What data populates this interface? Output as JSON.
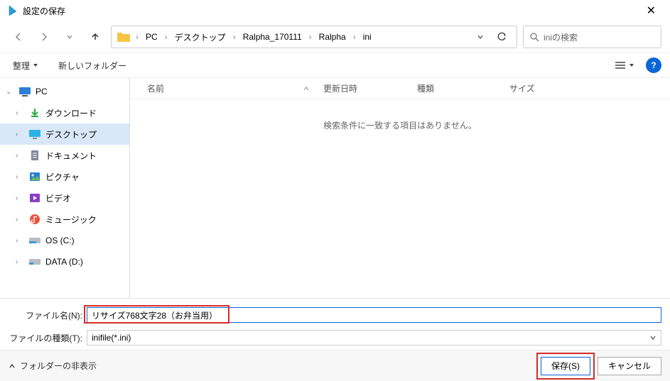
{
  "window": {
    "title": "設定の保存"
  },
  "nav": {
    "path": [
      "PC",
      "デスクトップ",
      "Ralpha_170111",
      "Ralpha",
      "ini"
    ],
    "search_placeholder": "iniの検索"
  },
  "toolbar": {
    "organize": "整理",
    "new_folder": "新しいフォルダー"
  },
  "sidebar": {
    "items": [
      {
        "label": "PC",
        "icon": "pc",
        "expandable": true,
        "expanded": true
      },
      {
        "label": "ダウンロード",
        "icon": "download",
        "expandable": true
      },
      {
        "label": "デスクトップ",
        "icon": "desktop",
        "expandable": true,
        "selected": true
      },
      {
        "label": "ドキュメント",
        "icon": "document",
        "expandable": true
      },
      {
        "label": "ピクチャ",
        "icon": "pictures",
        "expandable": true
      },
      {
        "label": "ビデオ",
        "icon": "videos",
        "expandable": true
      },
      {
        "label": "ミュージック",
        "icon": "music",
        "expandable": true
      },
      {
        "label": "OS (C:)",
        "icon": "drive",
        "expandable": true
      },
      {
        "label": "DATA (D:)",
        "icon": "drive",
        "expandable": true
      }
    ]
  },
  "columns": {
    "name": "名前",
    "date": "更新日時",
    "kind": "種類",
    "size": "サイズ"
  },
  "filelist": {
    "empty_msg": "検索条件に一致する項目はありません。"
  },
  "form": {
    "filename_label": "ファイル名(N):",
    "filename_value": "リサイズ768文字28（お弁当用）",
    "filetype_label": "ファイルの種類(T):",
    "filetype_value": "inifile(*.ini)"
  },
  "buttons": {
    "save": "保存(S)",
    "cancel": "キャンセル",
    "hide_folders": "フォルダーの非表示"
  }
}
